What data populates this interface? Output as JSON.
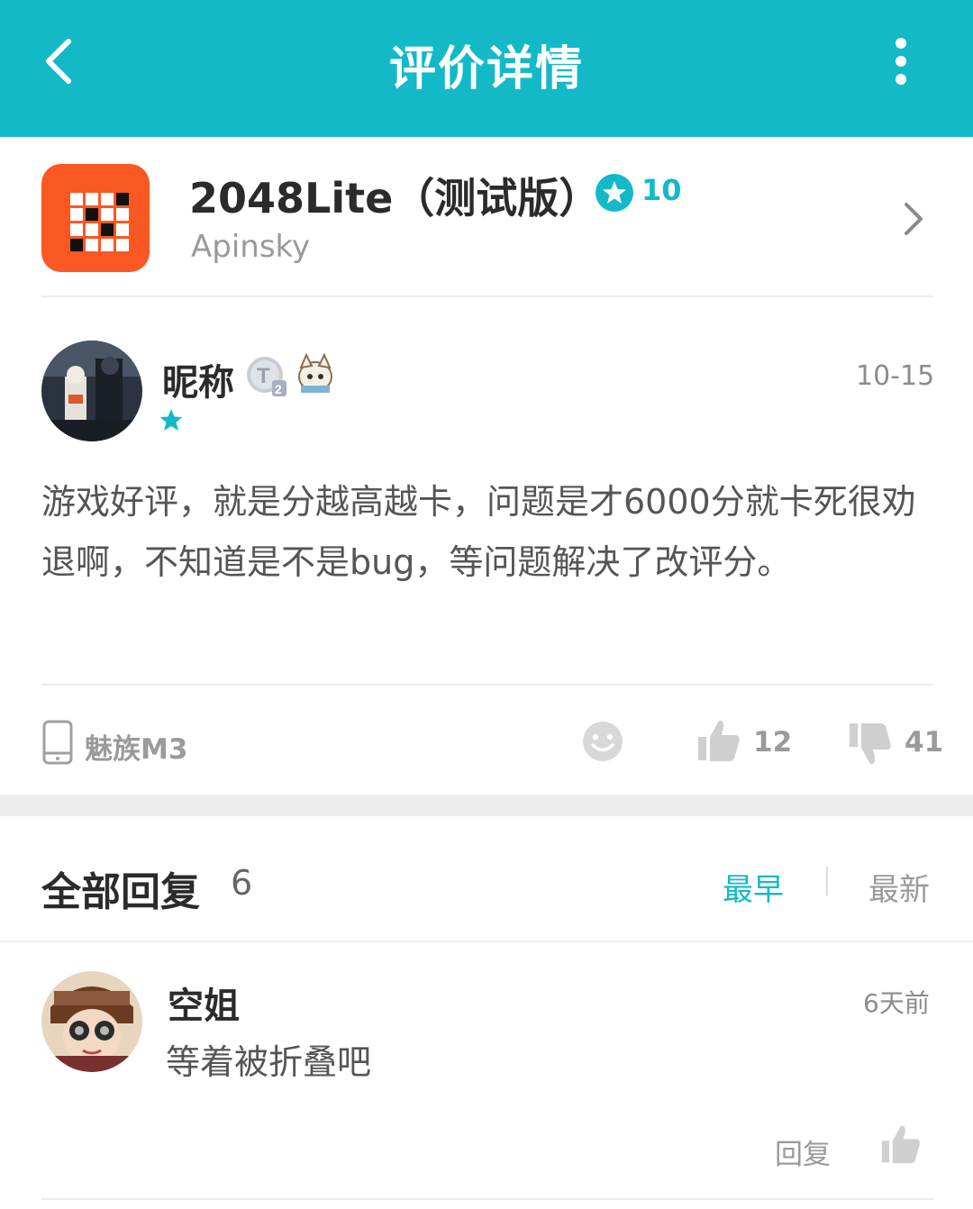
{
  "header": {
    "title": "评价详情"
  },
  "app": {
    "name": "2048Lite（测试版）",
    "developer": "Apinsky",
    "score": "10",
    "icon": "app-grid-icon",
    "accent_color": "#fb5722"
  },
  "review": {
    "nickname": "昵称",
    "date": "10-15",
    "text": "游戏好评，就是分越高越卡，问题是才6000分就卡死很劝退啊，不知道是不是bug，等问题解决了改评分。",
    "device": "魅族M3",
    "likes": "12",
    "dislikes": "41"
  },
  "replies_section": {
    "title": "全部回复",
    "count": "6",
    "sort_earliest": "最早",
    "sort_latest": "最新"
  },
  "replies": [
    {
      "name": "空姐",
      "time": "6天前",
      "text": "等着被折叠吧",
      "reply_label": "回复"
    }
  ],
  "colors": {
    "primary": "#14b9c8",
    "text_dark": "#2b2b2b",
    "text_muted": "#9a9a9a"
  }
}
